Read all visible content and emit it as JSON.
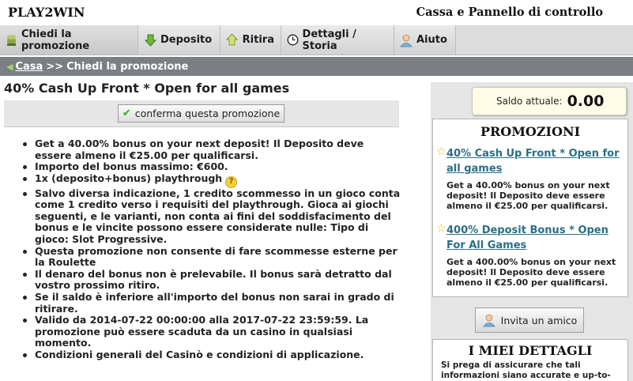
{
  "app": {
    "brand": "PLAY2WIN",
    "window_title": "Cassa e Pannello di controllo"
  },
  "menu": [
    {
      "label": "Chiedi la promozione",
      "icon": "promo-icon"
    },
    {
      "label": "Deposito",
      "icon": "deposit-arrow-icon"
    },
    {
      "label": "Ritira",
      "icon": "withdraw-arrow-icon"
    },
    {
      "label": "Dettagli / Storia",
      "icon": "clock-icon"
    },
    {
      "label": "Aiuto",
      "icon": "help-person-icon"
    }
  ],
  "breadcrumb": {
    "home": "Casa",
    "separator": ">>",
    "current": "Chiedi la promozione"
  },
  "promotion": {
    "title": "40% Cash Up Front * Open for all games",
    "confirm_label": "conferma questa promozione",
    "terms": [
      "Get a 40.00% bonus on your next deposit! Il Deposito deve essere almeno il €25.00 per qualificarsi.",
      "Importo del bonus massimo: €600.",
      "1x (deposito+bonus) playthrough",
      "Salvo diversa indicazione, 1 credito scommesso in un gioco conta come 1 credito verso i requisiti del playthrough. Gioca ai giochi seguenti, e le varianti, non conta ai fini del soddisfacimento del bonus e le vincite possono essere considerate nulle: Tipo di gioco: Slot Progressive.",
      "Questa promozione non consente di fare scommesse esterne per la Roulette",
      "Il denaro del bonus non è prelevabile. Il bonus sarà detratto dal vostro prossimo ritiro.",
      "Se il saldo è inferiore all'importo del bonus non sarai in grado di ritirare.",
      "Valido da 2014-07-22 00:00:00 alla 2017-07-22 23:59:59. La promozione può essere scaduta da un casino in qualsiasi momento.",
      "Condizioni generali del Casinò e condizioni di applicazione."
    ]
  },
  "sidebar": {
    "balance_label": "Saldo attuale:",
    "balance_value": "0.00",
    "promotions_title": "PROMOZIONI",
    "promotions": [
      {
        "title": "40% Cash Up Front * Open for all games",
        "description": "Get a 40.00% bonus on your next deposit! Il Deposito deve essere almeno il €25.00 per qualificarsi."
      },
      {
        "title": "400% Deposit Bonus * Open For All Games",
        "description": "Get a 400.00% bonus on your next deposit! Il Deposito deve essere almeno il €25.00 per qualificarsi."
      }
    ],
    "invite_label": "Invita un amico",
    "details_title": "I MIEI DETTAGLI",
    "details_text": "Si prega di assicurare che tali informazioni siano accurate e up-to-"
  },
  "colors": {
    "menu_bg": "#dcdcdc",
    "breadcrumb_bg": "#7b7f84",
    "link": "#2a6f86",
    "star": "#e7b800",
    "sidebar_bg": "#e5e5e5"
  }
}
